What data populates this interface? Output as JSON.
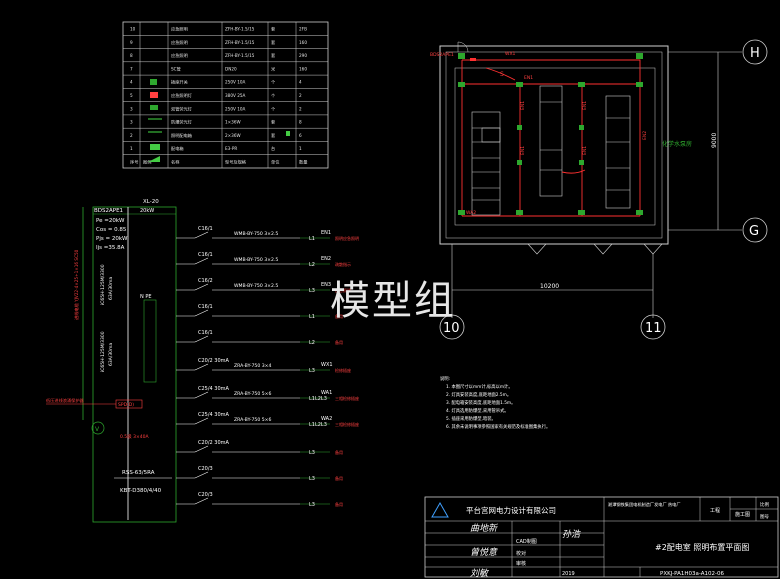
{
  "watermark": "模型组",
  "legend_table": {
    "rows": [
      {
        "no": "10",
        "cells": [
          "",
          "应急照明",
          "ZFH-BY-1.5/15",
          "套",
          "2FB"
        ]
      },
      {
        "no": "9",
        "cells": [
          "",
          "应急照明",
          "ZFH-BY-1.5/15",
          "套",
          "160"
        ]
      },
      {
        "no": "8",
        "cells": [
          "",
          "应急照明",
          "ZFH-BY-1.5/15",
          "套",
          "290"
        ]
      },
      {
        "no": "7",
        "cells": [
          "",
          "SC管",
          "DN20",
          "米",
          "160"
        ]
      },
      {
        "no": "4",
        "cells": [
          "",
          "插座开关",
          "250V 10A",
          "个",
          "4"
        ]
      },
      {
        "no": "5",
        "cells": [
          "",
          "应急照明灯",
          "380V 25A",
          "个",
          "2"
        ]
      },
      {
        "no": "3",
        "cells": [
          "",
          "双管荧光灯",
          "250V 10A",
          "个",
          "2"
        ]
      },
      {
        "no": "3",
        "cells": [
          "",
          "防爆荧光灯",
          "1×36W",
          "套",
          "8"
        ]
      },
      {
        "no": "2",
        "cells": [
          "",
          "照明配电箱",
          "2×36W",
          "套",
          "6"
        ]
      },
      {
        "no": "1",
        "cells": [
          "",
          "配电箱",
          "E3-PR",
          "台",
          "1"
        ]
      },
      {
        "no": "序号",
        "cells": [
          "图例",
          "名称",
          "型号及规格",
          "单位",
          "数量"
        ]
      }
    ]
  },
  "single_line": {
    "box_id": "BDS2APE1",
    "feed_label": "XL-20",
    "feed_sub": "20kW",
    "params": [
      "Pe =20kW",
      "Cos = 0.85",
      "Pjs = 20kW",
      "Ijs =35.8A"
    ],
    "main_breaker": "iC65H-125M/3300",
    "main_rating": "63A/30ma",
    "main_breaker2": "iC65H-125M/3300",
    "main_rating2": "63A/30ma",
    "vertical_note": "进线电缆 YJV22-4×25+1×16 SC50",
    "ground": "N  PE",
    "surge": "SPD(D)",
    "surge_note": "低压进线浪涌保护器",
    "meter": "V",
    "meter_note": "0.5级 3×40A",
    "rss": "RSS-63/5RA",
    "kbt": "KBT-D380/4/40",
    "branches": [
      {
        "breaker": "C16/1",
        "cable": "WMB-BY-750 3×2.5",
        "phase": "L1",
        "circuit": "EN1",
        "use": "照明应急照明"
      },
      {
        "breaker": "C16/1",
        "cable": "WMB-BY-750 3×2.5",
        "phase": "L2",
        "circuit": "EN2",
        "use": "疏散指示"
      },
      {
        "breaker": "C16/2",
        "cable": "WMB-BY-750 3×2.5",
        "phase": "L3",
        "circuit": "EN3",
        "use": "应急照明"
      },
      {
        "breaker": "C16/1",
        "cable": "",
        "phase": "L1",
        "circuit": "",
        "use": "备用"
      },
      {
        "breaker": "C16/1",
        "cable": "",
        "phase": "L2",
        "circuit": "",
        "use": "备用"
      },
      {
        "breaker": "C20/2 30mA",
        "cable": "ZRA-BY-750 3×4",
        "phase": "L3",
        "circuit": "WX1",
        "use": "检修插座"
      },
      {
        "breaker": "C25/4 30mA",
        "cable": "ZRA-BY-750 5×6",
        "phase": "L1L2L3",
        "circuit": "WA1",
        "use": "三相检修插座"
      },
      {
        "breaker": "C25/4 30mA",
        "cable": "ZRA-BY-750 5×6",
        "phase": "L1L2L3",
        "circuit": "WA2",
        "use": "三相检修插座"
      },
      {
        "breaker": "C20/2 30mA",
        "cable": "",
        "phase": "L3",
        "circuit": "",
        "use": "备用"
      },
      {
        "breaker": "C20/3",
        "cable": "",
        "phase": "L3",
        "circuit": "",
        "use": "备用"
      },
      {
        "breaker": "C20/3",
        "cable": "",
        "phase": "L3",
        "circuit": "",
        "use": "备用"
      }
    ]
  },
  "plan": {
    "axis_h": "H",
    "axis_g": "G",
    "axis_10": "10",
    "axis_11": "11",
    "dim_width": "10200",
    "dim_height": "9000",
    "room_label": "化学水泵房",
    "box_label": "BDS2APE1",
    "tags": [
      "WX1",
      "EN1",
      "S",
      "EN1",
      "EN1",
      "EN1",
      "EN1",
      "EN2",
      "WA2"
    ]
  },
  "notes": {
    "title": "说明:",
    "lines": [
      "1. 本图尺寸以mm计,标高以m计。",
      "2. 灯具安装高度,底距地面2.5m。",
      "3. 配电箱安装高度,底距地面1.5m。",
      "4. 灯具选用防爆型,采用管吊式。",
      "5. 插座采用防爆型,暗装。",
      "6. 其余未说明事项参照国家有关规范及标准图集执行。"
    ]
  },
  "title_block": {
    "company": "平台宫网电力设计有限公司",
    "client": "湘潭钢铁集团电机制造厂发电厂 热电厂",
    "project": "工程",
    "stage_label": "施工图",
    "rev_label": "比例",
    "rev2": "图号",
    "drawing_title": "#2配电室  照明布置平面图",
    "drawing_no": "PXKJ-PA1H03a-A102-06",
    "year": "2019",
    "cad": "CAD制图",
    "check": "校对",
    "approve": "审核",
    "sign1": "曲地新",
    "sign2": "曾悦意",
    "sign3": "刘敏",
    "sign4": "孙浩"
  }
}
